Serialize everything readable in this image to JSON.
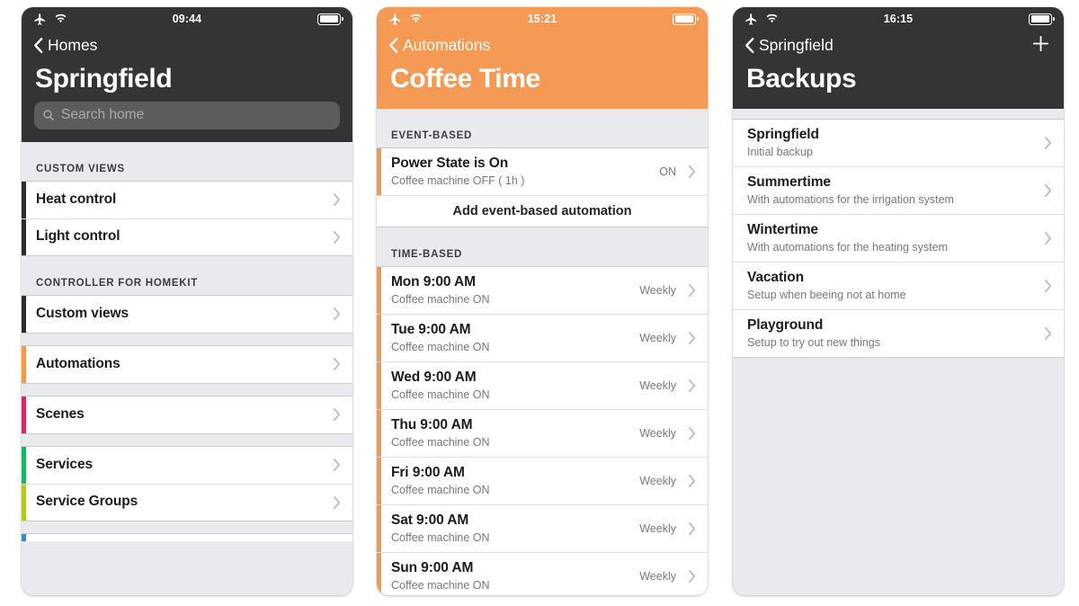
{
  "app": {
    "name": "Controller for HomeKit"
  },
  "screens": [
    {
      "id": "home",
      "status_bar": {
        "airplane_icon": "airplane-icon",
        "wifi_icon": "wifi-icon",
        "time": "09:44",
        "battery_icon": "battery-full-icon"
      },
      "header": {
        "theme": "dark",
        "back_label": "Homes",
        "title": "Springfield",
        "search_placeholder": "Search home",
        "search_value": ""
      },
      "sections": [
        {
          "title": "CUSTOM VIEWS",
          "rows": [
            {
              "title": "Heat control",
              "accent": "#2b2c2e"
            },
            {
              "title": "Light control",
              "accent": "#2b2c2e"
            }
          ]
        },
        {
          "title": "CONTROLLER FOR HOMEKIT",
          "rows": [
            {
              "title": "Custom views",
              "accent": "#2b2c2e"
            }
          ]
        },
        {
          "title": "",
          "rows": [
            {
              "title": "Automations",
              "accent": "#f09a4e"
            }
          ]
        },
        {
          "title": "",
          "rows": [
            {
              "title": "Scenes",
              "accent": "#cf2e63"
            }
          ]
        },
        {
          "title": "",
          "rows": [
            {
              "title": "Services",
              "accent": "#21b365"
            },
            {
              "title": "Service Groups",
              "accent": "#b3c92c"
            }
          ]
        }
      ],
      "cut_off_accent": "#3d87c6"
    },
    {
      "id": "automation",
      "status_bar": {
        "airplane_icon": "airplane-icon",
        "wifi_icon": "wifi-icon",
        "time": "15:21",
        "battery_icon": "battery-full-icon"
      },
      "header": {
        "theme": "orange",
        "back_label": "Automations",
        "title": "Coffee Time"
      },
      "event_section": {
        "title": "EVENT-BASED",
        "rows": [
          {
            "title": "Power State is On",
            "sub": "Coffee machine OFF ( 1h )",
            "meta": "ON",
            "accent": "#f09a4e"
          }
        ],
        "add_label": "Add event-based automation"
      },
      "time_section": {
        "title": "TIME-BASED",
        "rows": [
          {
            "title": "Mon 9:00 AM",
            "sub": "Coffee machine ON",
            "meta": "Weekly",
            "accent": "#f09a4e"
          },
          {
            "title": "Tue 9:00 AM",
            "sub": "Coffee machine ON",
            "meta": "Weekly",
            "accent": "#f09a4e"
          },
          {
            "title": "Wed 9:00 AM",
            "sub": "Coffee machine ON",
            "meta": "Weekly",
            "accent": "#f09a4e"
          },
          {
            "title": "Thu 9:00 AM",
            "sub": "Coffee machine ON",
            "meta": "Weekly",
            "accent": "#f09a4e"
          },
          {
            "title": "Fri 9:00 AM",
            "sub": "Coffee machine ON",
            "meta": "Weekly",
            "accent": "#f09a4e"
          },
          {
            "title": "Sat 9:00 AM",
            "sub": "Coffee machine ON",
            "meta": "Weekly",
            "accent": "#f09a4e"
          },
          {
            "title": "Sun 9:00 AM",
            "sub": "Coffee machine ON",
            "meta": "Weekly",
            "accent": "#f09a4e"
          }
        ]
      }
    },
    {
      "id": "backups",
      "status_bar": {
        "airplane_icon": "airplane-icon",
        "wifi_icon": "wifi-icon",
        "time": "16:15",
        "battery_icon": "battery-full-icon"
      },
      "header": {
        "theme": "dark",
        "back_label": "Springfield",
        "title": "Backups",
        "add_icon": "plus-icon"
      },
      "rows": [
        {
          "title": "Springfield",
          "sub": "Initial backup"
        },
        {
          "title": "Summertime",
          "sub": "With automations for the irrigation system"
        },
        {
          "title": "Wintertime",
          "sub": "With automations for the heating system"
        },
        {
          "title": "Vacation",
          "sub": "Setup when beeing not at home"
        },
        {
          "title": "Playground",
          "sub": "Setup to try out new things"
        }
      ]
    }
  ],
  "colors": {
    "dark_header": "#333436",
    "orange_header": "#f49a55",
    "page_bg": "#ffffff",
    "list_bg": "#e8eaee",
    "row_bg": "#ffffff"
  }
}
